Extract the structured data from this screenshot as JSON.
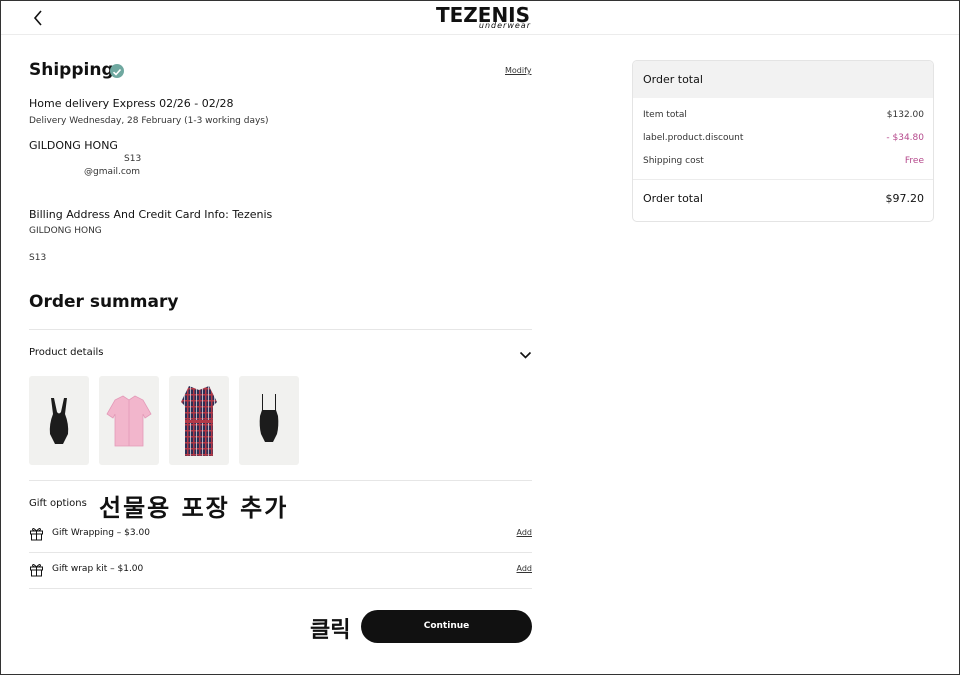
{
  "header": {
    "brand": "TEZENIS",
    "brand_sub": "underwear"
  },
  "shipping": {
    "title": "Shipping",
    "modify_label": "Modify",
    "delivery_method": "Home delivery Express 02/26 - 02/28",
    "delivery_note": "Delivery Wednesday, 28 February (1-3 working days)",
    "recipient_name": "GILDONG HONG",
    "address_fragment": "S13",
    "email_fragment": "@gmail.com",
    "billing_title": "Billing Address And Credit Card Info: Tezenis",
    "billing_name": "GILDONG HONG",
    "billing_address": "S13"
  },
  "summary": {
    "title": "Order summary",
    "product_details_label": "Product details",
    "products": [
      {
        "icon": "black-bodysuit"
      },
      {
        "icon": "pink-pajama-shirt"
      },
      {
        "icon": "plaid-robe"
      },
      {
        "icon": "black-bodysuit-square-neck"
      }
    ]
  },
  "gift": {
    "label": "Gift options",
    "annotation": "선물용 포장 추가",
    "options": [
      {
        "text": "Gift Wrapping – $3.00",
        "action": "Add"
      },
      {
        "text": "Gift wrap kit – $1.00",
        "action": "Add"
      }
    ]
  },
  "actions": {
    "click_annotation": "클릭",
    "continue_label": "Continue"
  },
  "order_total": {
    "title": "Order total",
    "item_total_label": "Item total",
    "item_total_value": "$132.00",
    "discount_label": "label.product.discount",
    "discount_value": "- $34.80",
    "shipping_label": "Shipping cost",
    "shipping_value": "Free",
    "total_label": "Order total",
    "total_value": "$97.20"
  },
  "colors": {
    "accent_pink": "#b5498c",
    "check_teal": "#6fa8a0",
    "button_black": "#111111"
  }
}
